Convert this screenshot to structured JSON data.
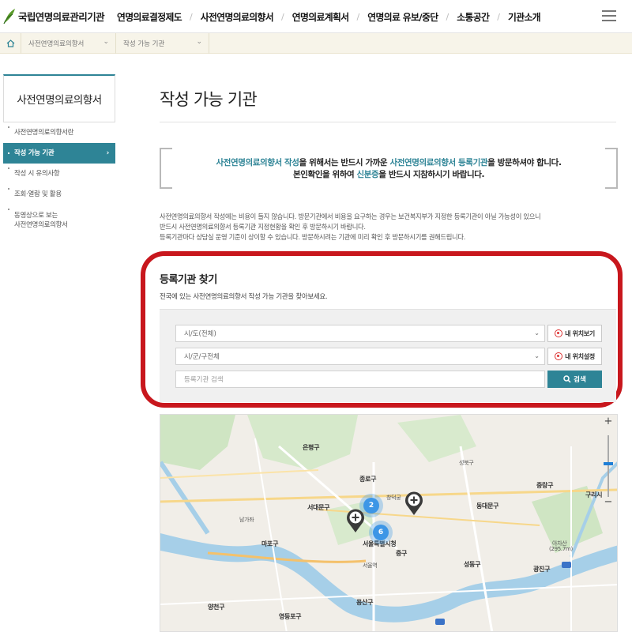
{
  "header": {
    "logo_text": "국립연명의료관리기관",
    "nav": [
      "연명의료결정제도",
      "사전연명의료의향서",
      "연명의료계획서",
      "연명의료 유보/중단",
      "소통공간",
      "기관소개"
    ],
    "separator": "/"
  },
  "breadcrumb": {
    "items": [
      "사전연명의료의향서",
      "작성 가능 기관"
    ]
  },
  "sidebar": {
    "title": "사전연명의료의향서",
    "items": [
      {
        "label": "사전연명의료의향서란"
      },
      {
        "label": "작성 가능 기관"
      },
      {
        "label": "작성 시 유의사항"
      },
      {
        "label": "조회·열람 및 활용"
      },
      {
        "label_line1": "동영상으로 보는",
        "label_line2": "사전연명의료의향서"
      }
    ]
  },
  "main": {
    "title": "작성 가능 기관",
    "notice": {
      "l1_a": "사전연명의료의향서 작성",
      "l1_b": "을 위해서는 반드시 가까운 ",
      "l1_c": "사전연명의료의향서 등록기관",
      "l1_d": "을 방문하셔야 합니다.",
      "l2_a": "본인확인을 위하여 ",
      "l2_b": "신분증",
      "l2_c": "을 반드시 지참하시기 바랍니다."
    },
    "desc": [
      "사전연명의료의향서 작성에는 비용이 들지 않습니다. 방문기관에서 비용을 요구하는 경우는 보건복지부가 지정한 등록기관이 아닐 가능성이 있으니",
      "반드시 사전연명의료의향서 등록기관 지정현황을 확인 후 방문하시기 바랍니다.",
      "등록기관마다 상담실 운영 기준이 상이할 수 있습니다. 방문하시려는 기관에 미리 확인 후 방문하시기를 권해드립니다."
    ]
  },
  "search": {
    "title": "등록기관 찾기",
    "subtitle": "전국에 있는 사전연명의료의향서 작성 가능 기관을 찾아보세요.",
    "sido_selected": "시/도(전체)",
    "sigungu_selected": "시/군/구전체",
    "input_placeholder": "등록기관 검색",
    "my_location_btn": "내 위치보기",
    "set_location_btn": "내 위치설정",
    "search_btn": "검색"
  },
  "map": {
    "zoom_in": "+",
    "zoom_out": "−",
    "clusters": [
      "2",
      "6"
    ],
    "labels": {
      "seongbuk": "성북구",
      "jongno": "종로구",
      "seodaemun": "서대문구",
      "junggu": "중구",
      "cityhall": "서울특별시청",
      "yongsan": "용산구",
      "mapo": "마포구",
      "dongdaemun": "동대문구",
      "jungnang": "중랑구",
      "gwangjin": "광진구",
      "seongdong": "성동구",
      "eunpyeong": "은평구",
      "guri": "구리시",
      "achasan": "아차산",
      "achasan_h": "(295.7m)",
      "yeongdeungpo": "영등포구",
      "yangcheon": "양천구",
      "namgaja": "남가좌",
      "seoulstation": "서울역",
      "changdeok": "창덕궁"
    }
  }
}
